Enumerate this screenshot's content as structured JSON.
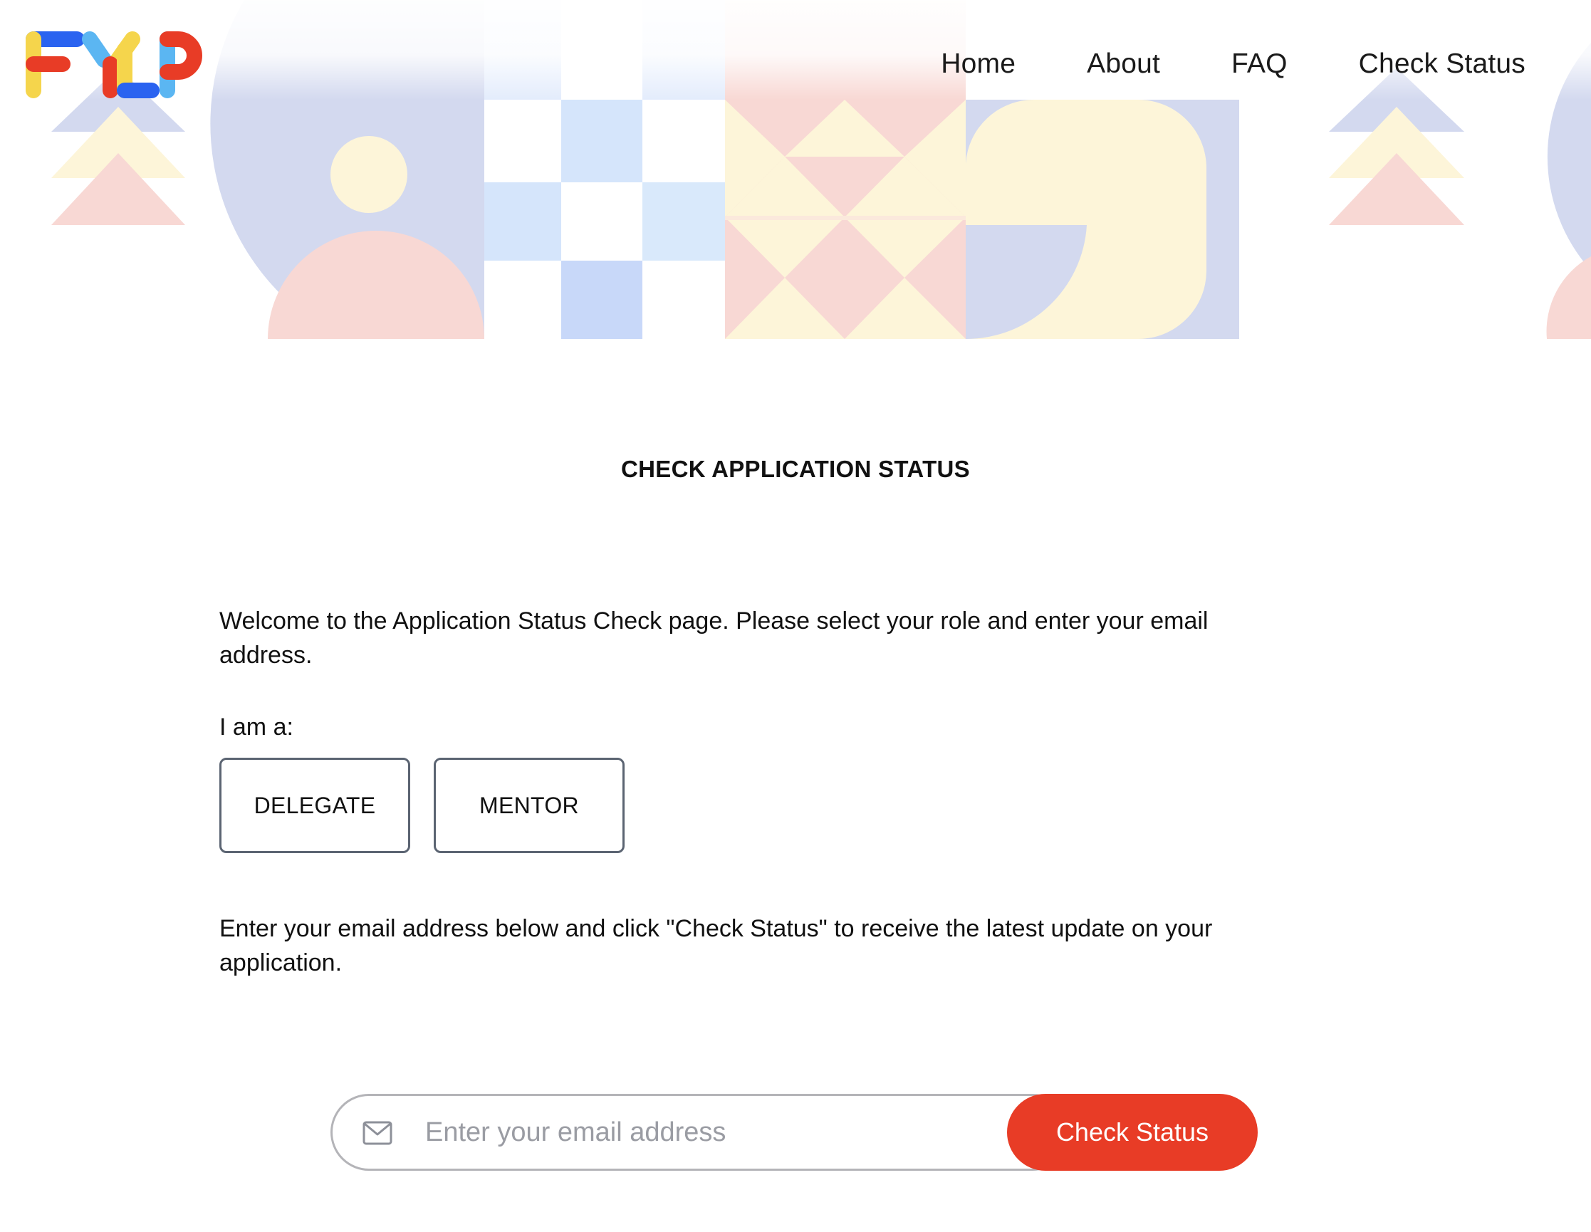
{
  "header": {
    "logo_text": "FYLP",
    "nav": [
      {
        "label": "Home"
      },
      {
        "label": "About"
      },
      {
        "label": "FAQ"
      },
      {
        "label": "Check Status"
      }
    ]
  },
  "hero": {
    "colors": {
      "pink": "#f8d8d4",
      "yellow": "#fdf5d9",
      "lavender": "#d3d9ef",
      "light_blue": "#d5e5fb",
      "blue": "#c8d8f9"
    }
  },
  "main": {
    "title": "CHECK APPLICATION STATUS",
    "intro": "Welcome to the Application Status Check page. Please select your role and enter your email address.",
    "role_label": "I am a:",
    "roles": [
      {
        "label": "DELEGATE"
      },
      {
        "label": "MENTOR"
      }
    ],
    "instructions": "Enter your email address below and click \"Check Status\" to receive the latest update on your application.",
    "email": {
      "placeholder": "Enter your email address",
      "value": "",
      "icon": "mail-icon"
    },
    "submit_label": "Check Status"
  },
  "colors": {
    "accent": "#e83c26",
    "border": "#5b6472",
    "input_border": "#b4b4b8",
    "placeholder": "#9a9ca3"
  }
}
